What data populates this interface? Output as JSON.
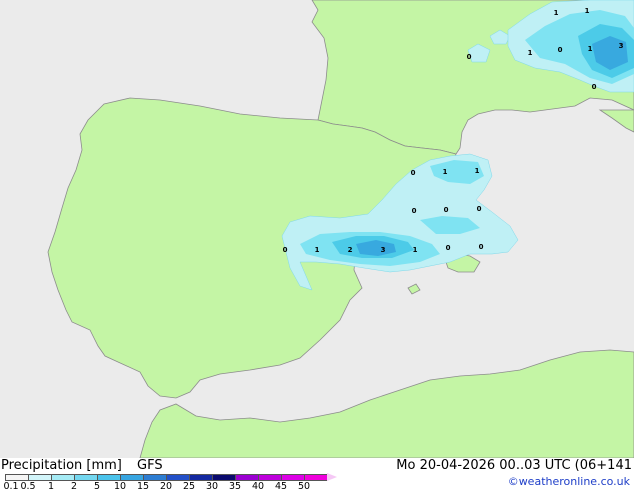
{
  "map": {
    "colors": {
      "sea": "#ebebeb",
      "land": "#c4f5a5",
      "coast": "#8c8c8c",
      "precip_light": "#bff0f5",
      "precip_1": "#7fe3f2",
      "precip_2": "#4ccbe8",
      "precip_5": "#38a9df"
    },
    "contour_labels": [
      {
        "text": "0"
      },
      {
        "text": "1"
      },
      {
        "text": "2"
      },
      {
        "text": "3"
      },
      {
        "text": "1"
      },
      {
        "text": "0"
      },
      {
        "text": "0"
      },
      {
        "text": "0"
      },
      {
        "text": "1"
      },
      {
        "text": "1"
      },
      {
        "text": "0"
      },
      {
        "text": "0"
      },
      {
        "text": "0"
      },
      {
        "text": "1"
      },
      {
        "text": "1"
      },
      {
        "text": "0"
      },
      {
        "text": "1"
      },
      {
        "text": "0"
      },
      {
        "text": "1"
      },
      {
        "text": "3"
      },
      {
        "text": "0"
      }
    ]
  },
  "footer": {
    "title": "Precipitation [mm]",
    "model": "GFS",
    "datetime": "Mo 20-04-2026 00..03 UTC (06+141",
    "credit": "©weatheronline.co.uk",
    "scale_labels": [
      "0.1",
      "0.5",
      "1",
      "2",
      "5",
      "10",
      "15",
      "20",
      "25",
      "30",
      "35",
      "40",
      "45",
      "50"
    ],
    "scale_colors": [
      "#f5f5f5",
      "#d2f5fa",
      "#a5ebf5",
      "#73d7f0",
      "#4bc3eb",
      "#37a5e1",
      "#2d7dd2",
      "#2350c8",
      "#1428a0",
      "#0a0a6e",
      "#9b00d2",
      "#be00dc",
      "#dc00e6",
      "#f000dc"
    ]
  }
}
